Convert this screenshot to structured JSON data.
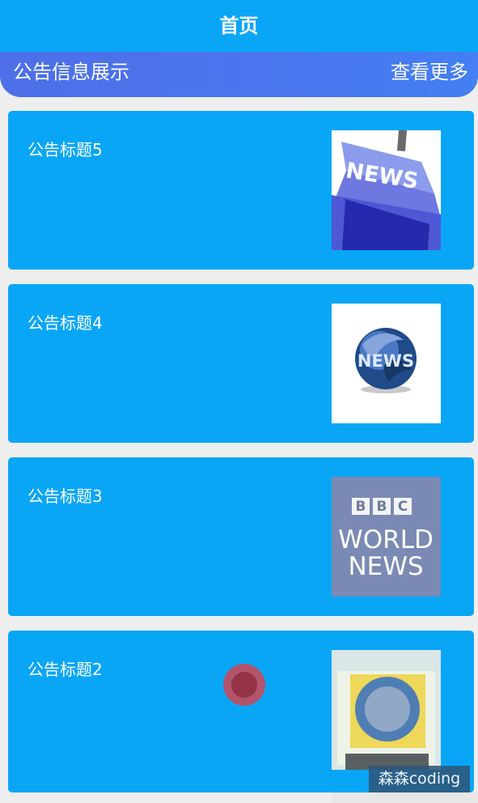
{
  "navbar": {
    "title": "首页"
  },
  "section": {
    "title": "公告信息展示",
    "more": "查看更多"
  },
  "notices": [
    {
      "title": "公告标题5",
      "image": "news-key-image"
    },
    {
      "title": "公告标题4",
      "image": "news-globe-image"
    },
    {
      "title": "公告标题3",
      "image": "bbc-world-news-image"
    },
    {
      "title": "公告标题2",
      "image": "blurred-news-image"
    }
  ],
  "images": {
    "bbc_letters": [
      "B",
      "B",
      "C"
    ],
    "world_word": "WORLD",
    "news_word": "NEWS"
  },
  "watermark": "森森coding",
  "colors": {
    "primary": "#0aa6f6",
    "section_start": "#4d6fe7",
    "section_end": "#447ff3",
    "background": "#eeeeee",
    "touch_indicator": "#bd5066"
  }
}
